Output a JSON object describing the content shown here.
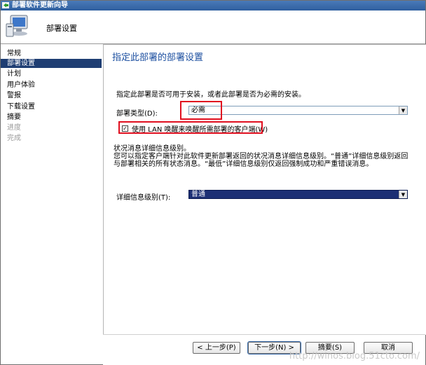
{
  "window": {
    "title": "部署软件更新向导"
  },
  "header": {
    "title": "部署设置",
    "icon": "computer-wizard-icon"
  },
  "sidebar": {
    "items": [
      {
        "label": "常规",
        "state": "normal"
      },
      {
        "label": "部署设置",
        "state": "active"
      },
      {
        "label": "计划",
        "state": "normal"
      },
      {
        "label": "用户体验",
        "state": "normal"
      },
      {
        "label": "警报",
        "state": "normal"
      },
      {
        "label": "下载设置",
        "state": "normal"
      },
      {
        "label": "摘要",
        "state": "normal"
      },
      {
        "label": "进度",
        "state": "disabled"
      },
      {
        "label": "完成",
        "state": "disabled"
      }
    ]
  },
  "main": {
    "title": "指定此部署的部署设置",
    "description": "指定此部署是否可用于安装，或者此部署是否为必需的安装。",
    "deployment_type": {
      "label": "部署类型(D):",
      "value": "必需"
    },
    "wake_on_lan": {
      "label": "使用 LAN 唤醒来唤醒所需部署的客户端(W)",
      "checked": true
    },
    "detail_section": {
      "title": "状况消息详细信息级别。",
      "description": "您可以指定客户端针对此软件更新部署返回的状况消息详细信息级别。“普通”详细信息级别返回与部署相关的所有状态消息。“最低”详细信息级别仅返回强制成功和严重错误消息。",
      "level_label": "详细信息级别(T):",
      "level_value": "普通"
    }
  },
  "footer": {
    "prev": "< 上一步(P)",
    "next": "下一步(N) >",
    "summary": "摘要(S)",
    "cancel": "取消"
  },
  "watermark": "http://winos.blog.51cto.com/",
  "colors": {
    "title_blue": "#1c4fa0",
    "active_nav": "#1f3e73",
    "highlight_red": "#e01020"
  }
}
